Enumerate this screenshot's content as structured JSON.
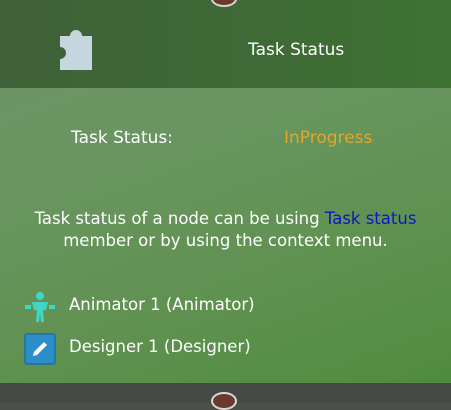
{
  "header": {
    "icon": "puzzle-piece-icon",
    "title": "Task Status"
  },
  "status": {
    "label": "Task Status:",
    "value": "InProgress",
    "value_color": "#e0a82a"
  },
  "description": {
    "before": "Task status of a node can be using ",
    "link": "Task status",
    "after": " member or by using the context menu."
  },
  "people": [
    {
      "icon": "animator-icon",
      "label": "Animator 1 (Animator)"
    },
    {
      "icon": "designer-pencil-icon",
      "label": "Designer 1 (Designer)"
    }
  ]
}
